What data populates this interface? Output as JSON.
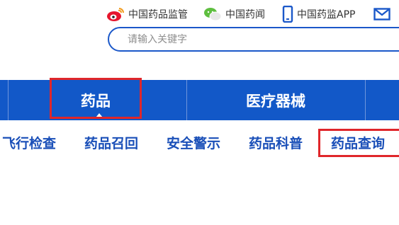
{
  "top_links": [
    {
      "label": "中国药品监管",
      "icon": "weibo-icon"
    },
    {
      "label": "中国药闻",
      "icon": "wechat-icon"
    },
    {
      "label": "中国药监APP",
      "icon": "phone-icon"
    },
    {
      "label": "",
      "icon": "mail-icon"
    }
  ],
  "search": {
    "placeholder": "请输入关键字"
  },
  "nav": {
    "tabs": [
      {
        "label": "药品",
        "active": true
      },
      {
        "label": "医疗器械"
      }
    ]
  },
  "sub_nav": {
    "items": [
      "飞行检查",
      "药品召回",
      "安全警示",
      "药品科普",
      "药品查询"
    ]
  },
  "colors": {
    "nav_blue": "#1258c8",
    "link_blue": "#1a4fb8",
    "highlight_red": "#e0262a",
    "weibo_red": "#e6162d",
    "wechat_green": "#5ebe3f"
  }
}
